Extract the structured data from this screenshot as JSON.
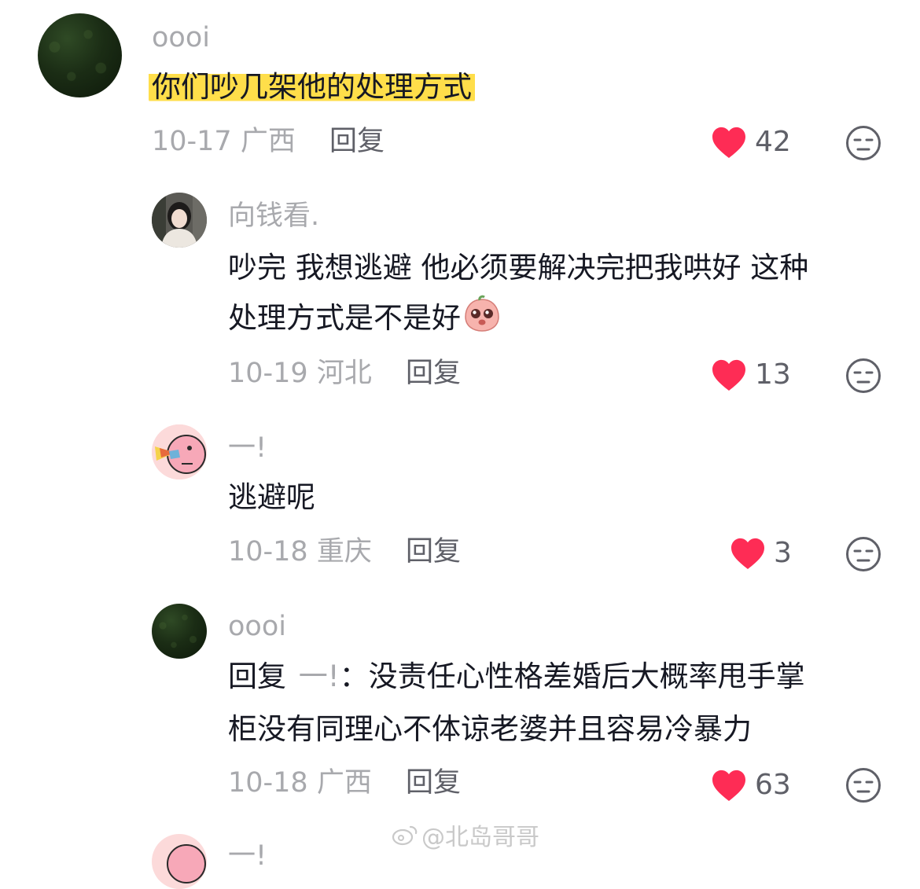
{
  "comments": [
    {
      "username": "oooi",
      "text": "你们吵几架他的处理方式",
      "date": "10-17",
      "location": "广西",
      "reply_label": "回复",
      "likes": "42"
    },
    {
      "username": "向钱看.",
      "text_line1": "吵完 我想逃避 他必须要解决完把我哄好 这种",
      "text_line2": "处理方式是不是好",
      "date": "10-19",
      "location": "河北",
      "reply_label": "回复",
      "likes": "13"
    },
    {
      "username": "一!",
      "text": "逃避呢",
      "date": "10-18",
      "location": "重庆",
      "reply_label": "回复",
      "likes": "3"
    },
    {
      "username": "oooi",
      "reply_prefix": "回复",
      "reply_target": "一!",
      "reply_sep": "：",
      "text_line1": "没责任心性格差婚后大概率甩手掌",
      "text_line2": "柜没有同理心不体谅老婆并且容易冷暴力",
      "date": "10-18",
      "location": "广西",
      "reply_label": "回复",
      "likes": "63"
    }
  ],
  "partial_next": {
    "username": "一!"
  },
  "watermark": {
    "text": "@北岛哥哥"
  },
  "icons": {
    "like": "heart-icon",
    "dislike": "unamused-face-icon",
    "emoji": "pleading-peach-emoji",
    "watermark": "weibo-logo-icon"
  },
  "colors": {
    "like_red": "#fe2c55",
    "muted": "#a8a9ad",
    "highlight": "#ffde4a"
  }
}
